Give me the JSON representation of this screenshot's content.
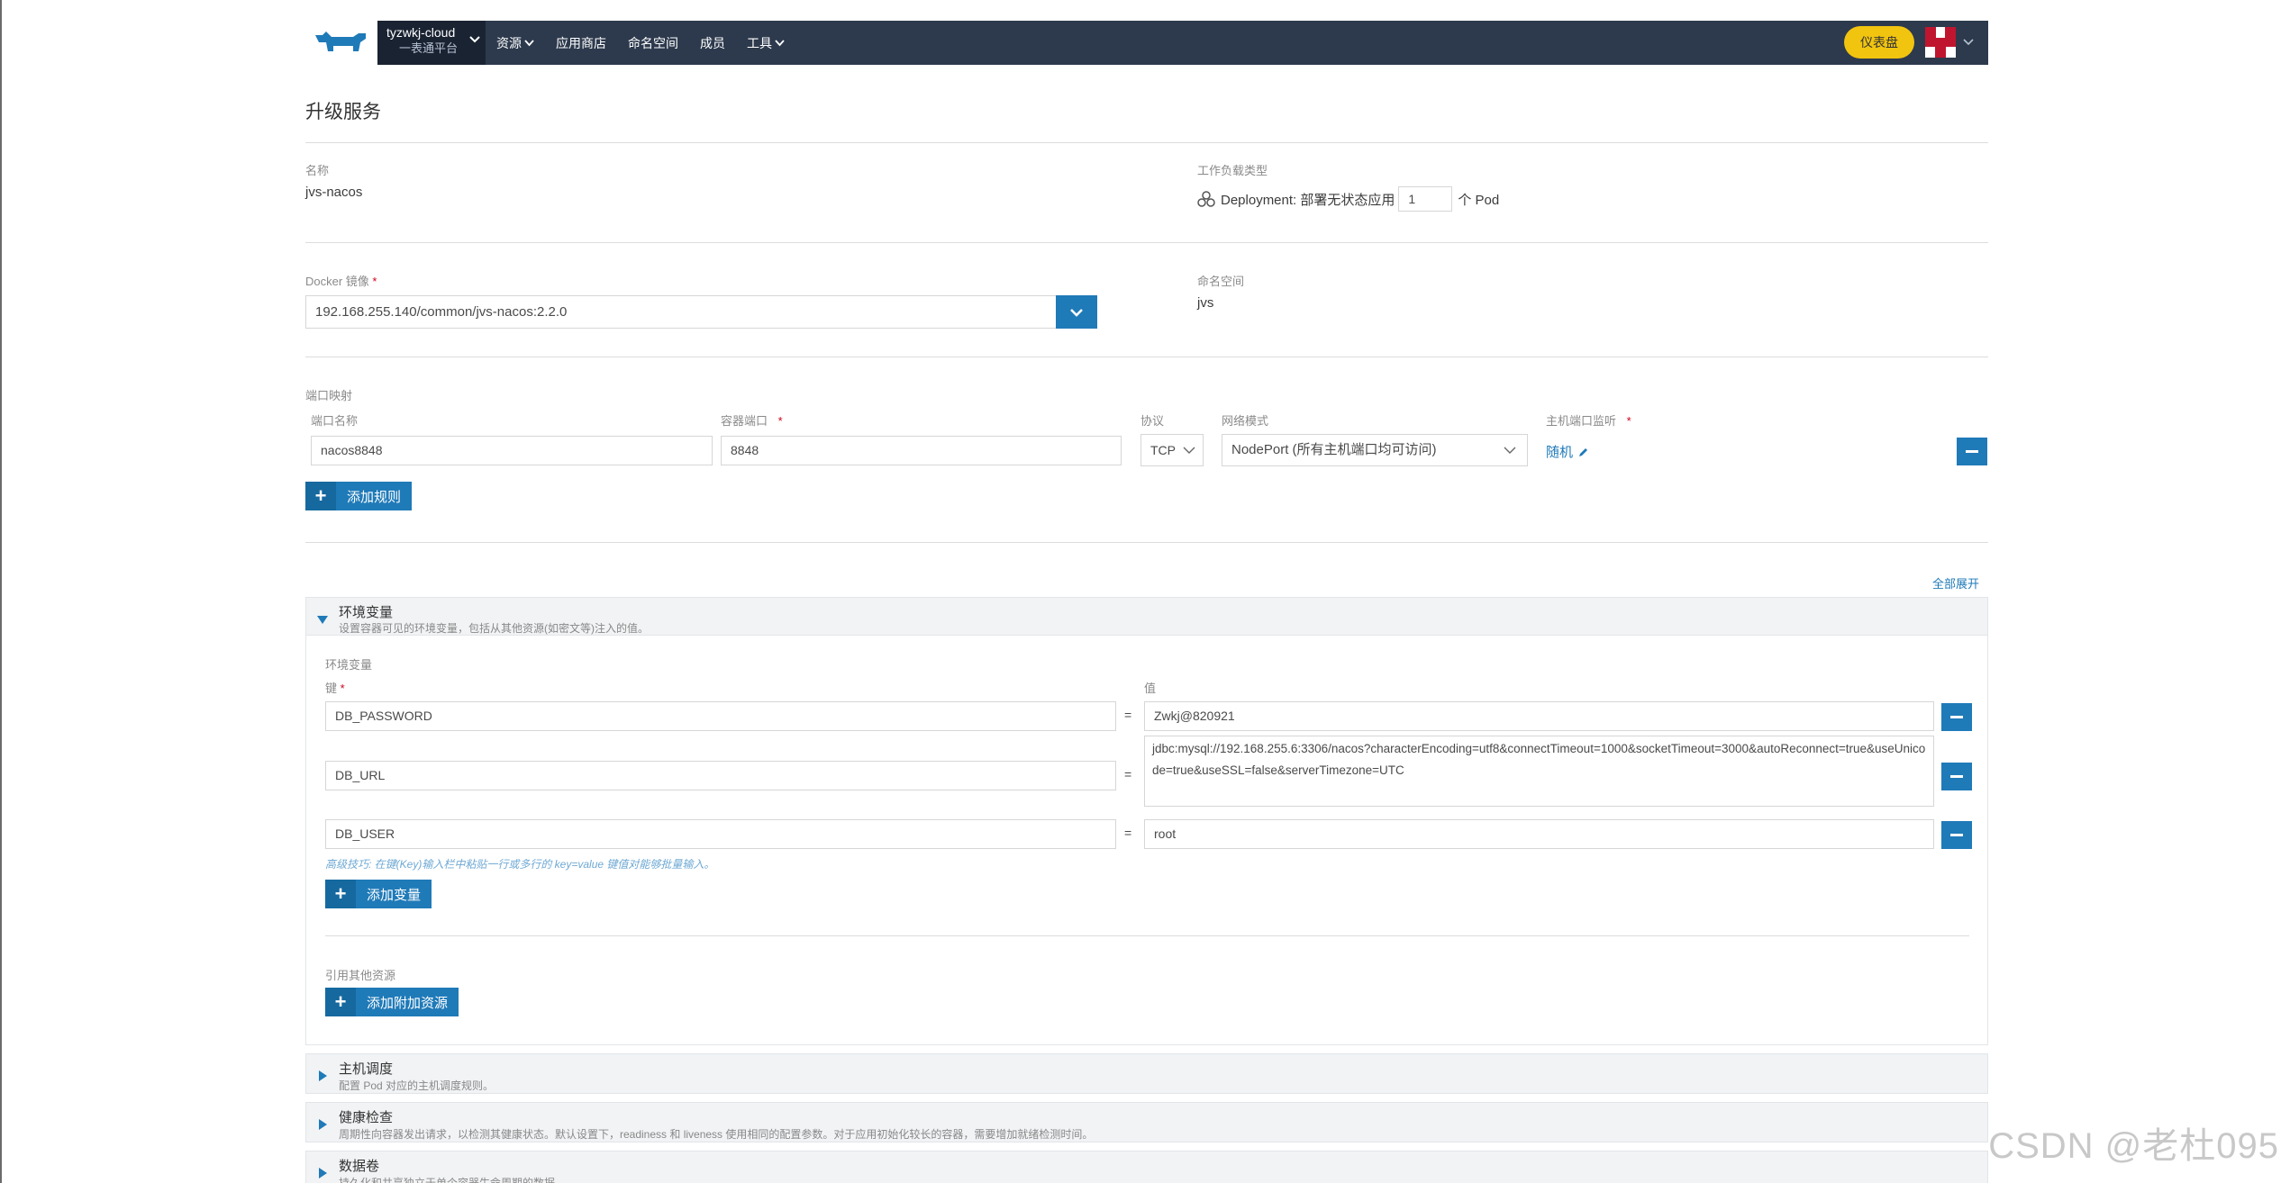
{
  "header": {
    "cluster_name": "tyzwkj-cloud",
    "cluster_sub": "一表通平台",
    "nav": [
      "资源",
      "应用商店",
      "命名空间",
      "成员",
      "工具"
    ],
    "dashboard_label": "仪表盘"
  },
  "page": {
    "title": "升级服务"
  },
  "name": {
    "label": "名称",
    "value": "jvs-nacos"
  },
  "workload": {
    "label": "工作负载类型",
    "type_text": "Deployment: 部署无状态应用",
    "replicas": "1",
    "unit": "个 Pod"
  },
  "image": {
    "label": "Docker 镜像",
    "required": "*",
    "value": "192.168.255.140/common/jvs-nacos:2.2.0"
  },
  "namespace": {
    "label": "命名空间",
    "value": "jvs"
  },
  "ports": {
    "section_label": "端口映射",
    "col_name": "端口名称",
    "col_container_port": "容器端口",
    "col_protocol": "协议",
    "col_network": "网络模式",
    "col_host_port": "主机端口监听",
    "required": "*",
    "rows": [
      {
        "name": "nacos8848",
        "container_port": "8848",
        "protocol": "TCP",
        "network": "NodePort (所有主机端口均可访问)",
        "host_port": "随机"
      }
    ],
    "add_rule_label": "添加规则"
  },
  "expand_all": "全部展开",
  "env_section": {
    "title": "环境变量",
    "desc": "设置容器可见的环境变量，包括从其他资源(如密文等)注入的值。",
    "sub_label": "环境变量",
    "key_label": "键",
    "required": "*",
    "value_label": "值",
    "rows": [
      {
        "key": "DB_PASSWORD",
        "value": "Zwkj@820921"
      },
      {
        "key": "DB_URL",
        "value": "jdbc:mysql://192.168.255.6:3306/nacos?characterEncoding=utf8&connectTimeout=1000&socketTimeout=3000&autoReconnect=true&useUnicode=true&useSSL=false&serverTimezone=UTC"
      },
      {
        "key": "DB_USER",
        "value": "root"
      }
    ],
    "equals": "=",
    "tip": "高级技巧: 在键(Key)输入栏中粘贴一行或多行的 key=value 键值对能够批量输入。",
    "add_var_label": "添加变量",
    "ref_label": "引用其他资源",
    "add_res_label": "添加附加资源"
  },
  "sections": [
    {
      "title": "主机调度",
      "desc": "配置 Pod 对应的主机调度规则。"
    },
    {
      "title": "健康检查",
      "desc": "周期性向容器发出请求，以检测其健康状态。默认设置下，readiness 和 liveness 使用相同的配置参数。对于应用初始化较长的容器，需要增加就绪检测时间。"
    },
    {
      "title": "数据卷",
      "desc": "持久化和共享独立于单个容器生命周期的数据"
    }
  ],
  "watermark": "CSDN @老杜095",
  "colors": {
    "header_bg": "#2d3a4d",
    "accent": "#1f7ab8",
    "dashboard": "#f1c40f"
  }
}
